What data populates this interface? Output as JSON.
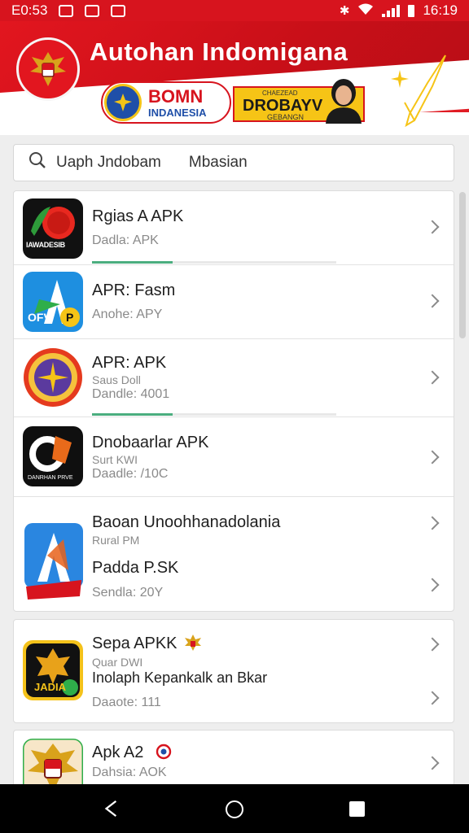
{
  "status_bar": {
    "time_left": "E0:53",
    "time_right": "16:19"
  },
  "header": {
    "app_title": "Autohan Indomigana",
    "bumn_title": "BOMN",
    "bumn_subtitle": "INDANESIA",
    "promo_small": "CHAEZEAD",
    "promo_title": "DROBAYV",
    "promo_sub": "GEBANGN"
  },
  "search": {
    "query": "Uaph Jndobam",
    "location": "Mbasian"
  },
  "apps": [
    {
      "name": "Rgias A APK",
      "sub": "Dadla: APK",
      "progress": 0.33
    },
    {
      "name": "APR: Fasm",
      "sub": "Anohe: APY"
    },
    {
      "name": "APR: APK",
      "mid": "Saus Doll",
      "sub": "Dandle: 4001",
      "progress": 0.33
    },
    {
      "name": "Dnobaarlar APK",
      "mid": "Surt KWI",
      "sub": "Daadle: /10C"
    },
    {
      "name": "Baoan Unoohhanadolania",
      "mid": "Rural PM",
      "name2": "Padda P.SK",
      "sub": "Sendla: 20Y"
    },
    {
      "name": "Sepa APKK",
      "mid": "Quar DWI",
      "name2": "Inolaph Kepankalk an Bkar",
      "sub": "Daaote: 111"
    },
    {
      "name": "Apk A2",
      "sub": "Dahsia: AOK"
    }
  ],
  "icon_labels": {
    "app1": "IAWADESIB",
    "app2": "OFV",
    "app4": "DANRHAN PRVE",
    "app6": "JADIA"
  },
  "colors": {
    "brand_red": "#d7141e",
    "gold": "#f6c416",
    "blue": "#1f4fa8",
    "progress_green": "#4bae7f"
  },
  "nav_icons": [
    "back-icon",
    "home-icon",
    "recent-apps-icon"
  ]
}
